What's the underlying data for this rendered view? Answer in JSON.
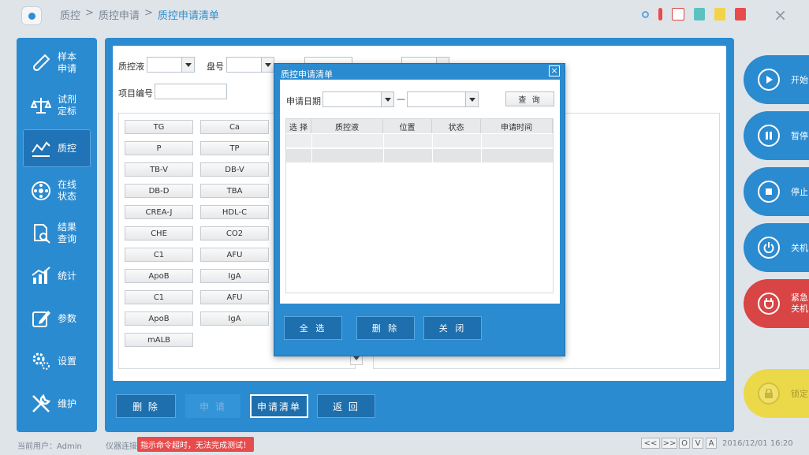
{
  "breadcrumb": [
    "质控",
    ">",
    "质控申请",
    ">",
    "质控申请清单"
  ],
  "colors": {
    "primary": "#2b8bd0",
    "danger": "#d94444",
    "lock": "#ecd94a"
  },
  "sidebar": {
    "items": [
      {
        "label": "样本申请",
        "icon": "test-tube-icon"
      },
      {
        "label": "试剂定标",
        "icon": "scale-icon"
      },
      {
        "label": "质控",
        "icon": "line-chart-icon"
      },
      {
        "label": "在线状态",
        "icon": "carousel-icon"
      },
      {
        "label": "结果查询",
        "icon": "doc-search-icon"
      },
      {
        "label": "统计",
        "icon": "bar-chart-icon"
      },
      {
        "label": "参数",
        "icon": "edit-icon"
      },
      {
        "label": "设置",
        "icon": "gear-icon"
      },
      {
        "label": "维护",
        "icon": "tools-icon"
      }
    ]
  },
  "form": {
    "qc_liquid_label": "质控液",
    "tray_label": "盘号",
    "item_no_label": "项目编号"
  },
  "test_items": [
    "TG",
    "Ca",
    "P",
    "TP",
    "TB-V",
    "DB-V",
    "DB-D",
    "TBA",
    "CREA-J",
    "HDL-C",
    "CHE",
    "CO2",
    "C1",
    "AFU",
    "ApoB",
    "IgA",
    "C1",
    "AFU",
    "ApoB",
    "IgA",
    "mALB"
  ],
  "bottom_buttons": {
    "delete": "删 除",
    "apply": "申 请",
    "list": "申请清单",
    "back": "返 回"
  },
  "actions": {
    "start": "开始",
    "pause": "暂停",
    "stop": "停止",
    "shutdown": "关机",
    "emergency": "紧急关机",
    "lock": "锁定"
  },
  "dialog": {
    "title": "质控申请清单",
    "close": "×",
    "date_label": "申请日期",
    "dash": "—",
    "query": "查 询",
    "columns": [
      "选 择",
      "质控液",
      "位置",
      "状态",
      "申请时间"
    ],
    "select_all": "全 选",
    "delete": "删 除",
    "close_btn": "关 闭"
  },
  "status": {
    "user": "当前用户：Admin",
    "conn_label": "仪器连接",
    "error": "指示命令超时，无法完成测试！",
    "nav": [
      "<<",
      ">>",
      "O",
      "V",
      "A"
    ],
    "datetime": "2016/12/01 16:20"
  }
}
